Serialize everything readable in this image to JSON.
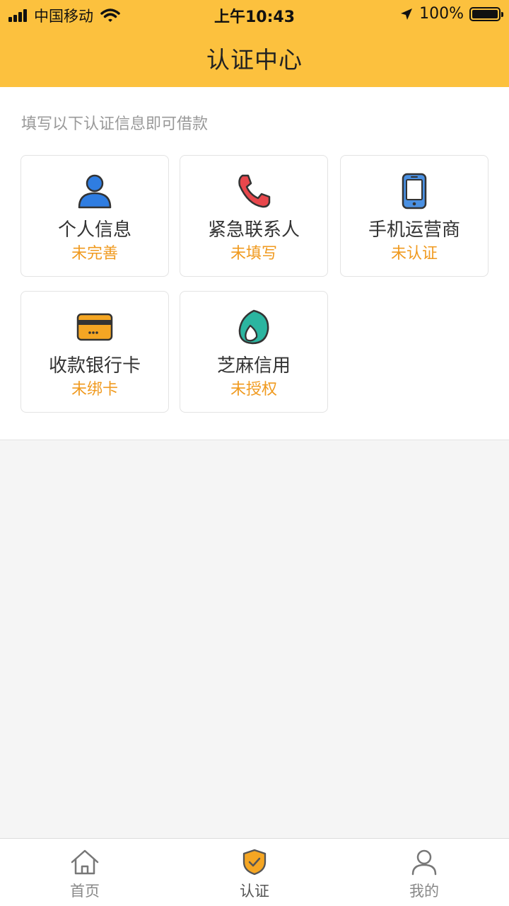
{
  "status_bar": {
    "carrier": "中国移动",
    "time": "上午10:43",
    "battery": "100%"
  },
  "header": {
    "title": "认证中心"
  },
  "hint": "填写以下认证信息即可借款",
  "cards": [
    {
      "title": "个人信息",
      "status": "未完善",
      "icon": "person-icon"
    },
    {
      "title": "紧急联系人",
      "status": "未填写",
      "icon": "phone-handset-icon"
    },
    {
      "title": "手机运营商",
      "status": "未认证",
      "icon": "mobile-phone-icon"
    },
    {
      "title": "收款银行卡",
      "status": "未绑卡",
      "icon": "bank-card-icon"
    },
    {
      "title": "芝麻信用",
      "status": "未授权",
      "icon": "sesame-credit-icon"
    }
  ],
  "tabs": [
    {
      "label": "首页",
      "icon": "home-icon"
    },
    {
      "label": "认证",
      "icon": "shield-check-icon",
      "active": true
    },
    {
      "label": "我的",
      "icon": "user-icon"
    }
  ],
  "colors": {
    "header_bg": "#fcc13e",
    "status_text": "#f09a1f",
    "person_blue": "#2f7de1",
    "phone_red": "#e8474c",
    "card_orange": "#f5a623",
    "sesame_teal": "#2bb5a0"
  }
}
